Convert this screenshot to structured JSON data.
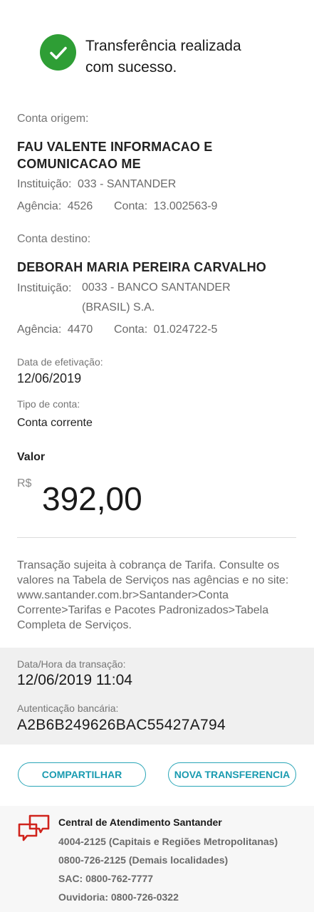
{
  "header": {
    "title_line1": "Transferência realizada",
    "title_line2": "com sucesso.",
    "icon": "check-icon",
    "icon_color": "#2e9e35"
  },
  "origin": {
    "section_label": "Conta origem:",
    "name_line1": "FAU VALENTE INFORMACAO E",
    "name_line2": "COMUNICACAO ME",
    "institution_label": "Instituição:",
    "institution_value": "033 - SANTANDER",
    "agency_label": "Agência:",
    "agency_value": "4526",
    "account_label": "Conta:",
    "account_value": "13.002563-9"
  },
  "destination": {
    "section_label": "Conta destino:",
    "name": "DEBORAH MARIA PEREIRA CARVALHO",
    "institution_label": "Instituição:",
    "institution_value_line1": "0033 - BANCO SANTANDER",
    "institution_value_line2": "(BRASIL) S.A.",
    "agency_label": "Agência:",
    "agency_value": "4470",
    "account_label": "Conta:",
    "account_value": "01.024722-5"
  },
  "details": {
    "date_label": "Data de efetivação:",
    "date_value": "12/06/2019",
    "account_type_label": "Tipo de conta:",
    "account_type_value": "Conta corrente"
  },
  "amount": {
    "label": "Valor",
    "currency": "R$",
    "value": "392,00"
  },
  "disclaimer": "Transação sujeita à cobrança de Tarifa. Consulte os valores na Tabela de Serviços nas agências e no site: www.santander.com.br>Santander>Conta Corrente>Tarifas e Pacotes Padronizados>Tabela Completa de Serviços.",
  "transaction": {
    "datetime_label": "Data/Hora da transação:",
    "datetime_value": "12/06/2019 11:04",
    "auth_label": "Autenticação bancária:",
    "auth_value": "A2B6B249626BAC55427A794"
  },
  "actions": {
    "share_label": "COMPARTILHAR",
    "new_transfer_label": "NOVA TRANSFERENCIA",
    "accent": "#2aa6b8"
  },
  "footer": {
    "icon": "chat-bubbles-icon",
    "icon_color": "#d0231c",
    "title": "Central de Atendimento Santander",
    "line1": "4004-2125 (Capitais e Regiões Metropolitanas)",
    "line2": "0800-726-2125 (Demais localidades)",
    "line3": "SAC: 0800-762-7777",
    "line4": "Ouvidoria: 0800-726-0322"
  }
}
